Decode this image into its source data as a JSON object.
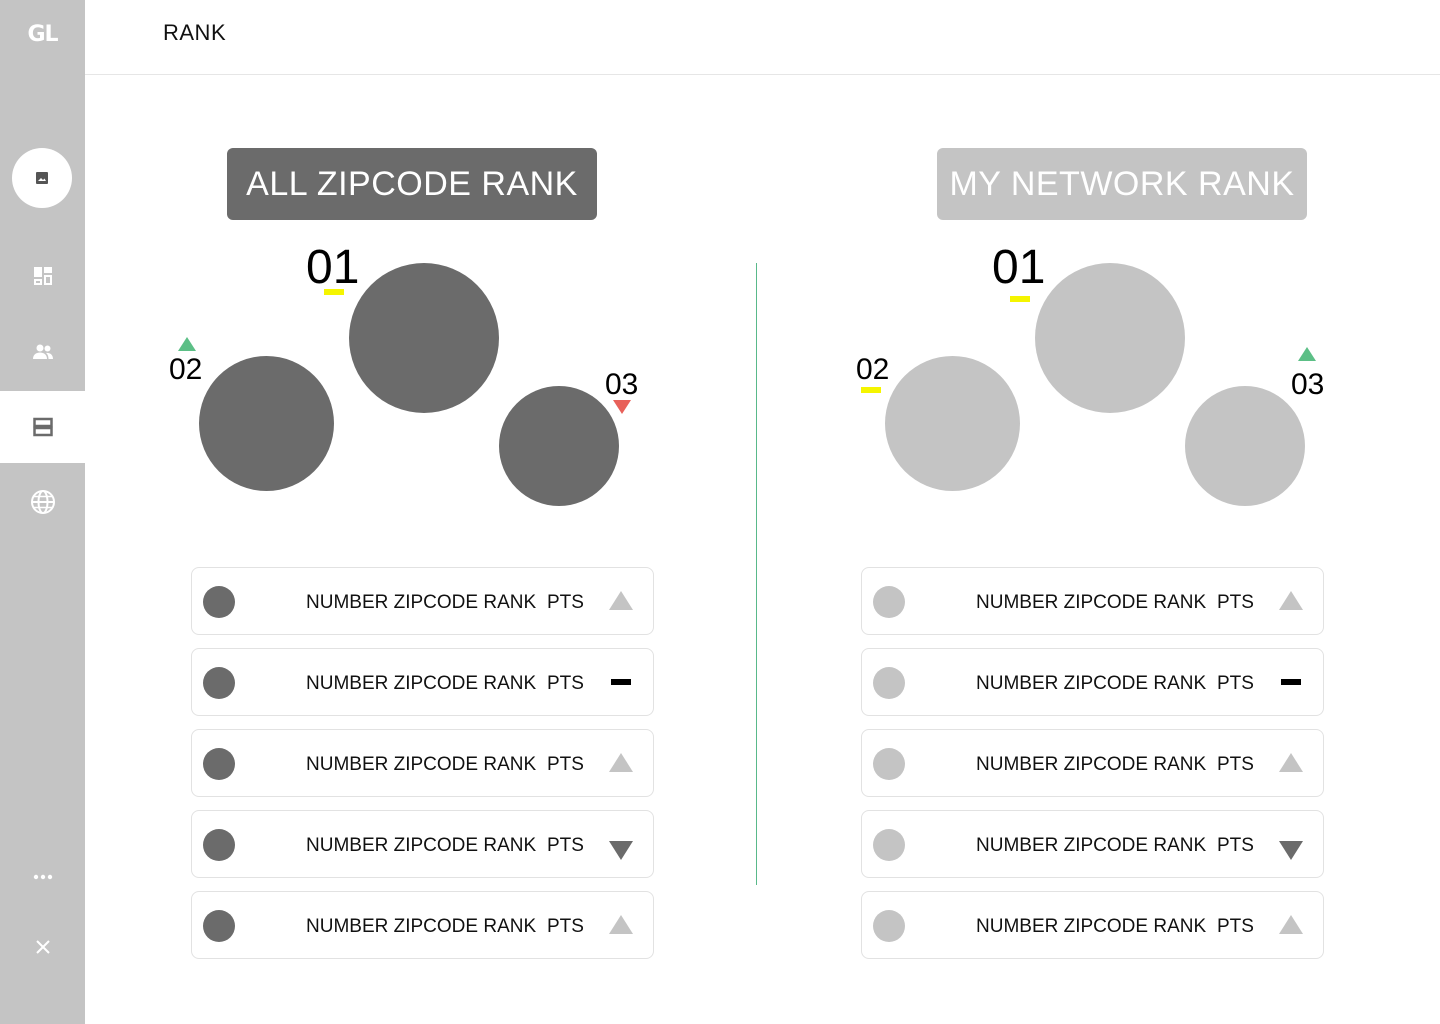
{
  "sidebar": {
    "logo": "GL",
    "nav": [
      {
        "icon": "dashboard-icon"
      },
      {
        "icon": "people-icon"
      },
      {
        "icon": "list-icon",
        "active": true
      },
      {
        "icon": "globe-icon"
      }
    ],
    "bottom": [
      {
        "icon": "more-icon"
      },
      {
        "icon": "close-icon"
      }
    ]
  },
  "header": {
    "title": "RANK"
  },
  "tabs": {
    "all": {
      "label": "ALL ZIPCODE RANK",
      "selected": true
    },
    "network": {
      "label": "MY NETWORK RANK",
      "selected": false
    }
  },
  "podium_all": {
    "first": {
      "rank": "01",
      "trend": "same"
    },
    "second": {
      "rank": "02",
      "trend": "up"
    },
    "third": {
      "rank": "03",
      "trend": "down"
    }
  },
  "podium_network": {
    "first": {
      "rank": "01",
      "trend": "same"
    },
    "second": {
      "rank": "02",
      "trend": "same"
    },
    "third": {
      "rank": "03",
      "trend": "up"
    }
  },
  "list_all": [
    {
      "label": "NUMBER ZIPCODE RANK",
      "pts": "PTS",
      "trend": "up"
    },
    {
      "label": "NUMBER ZIPCODE RANK",
      "pts": "PTS",
      "trend": "same"
    },
    {
      "label": "NUMBER ZIPCODE RANK",
      "pts": "PTS",
      "trend": "up"
    },
    {
      "label": "NUMBER ZIPCODE RANK",
      "pts": "PTS",
      "trend": "down"
    },
    {
      "label": "NUMBER ZIPCODE RANK",
      "pts": "PTS",
      "trend": "up"
    }
  ],
  "list_network": [
    {
      "label": "NUMBER ZIPCODE RANK",
      "pts": "PTS",
      "trend": "up"
    },
    {
      "label": "NUMBER ZIPCODE RANK",
      "pts": "PTS",
      "trend": "same"
    },
    {
      "label": "NUMBER ZIPCODE RANK",
      "pts": "PTS",
      "trend": "up"
    },
    {
      "label": "NUMBER ZIPCODE RANK",
      "pts": "PTS",
      "trend": "down"
    },
    {
      "label": "NUMBER ZIPCODE RANK",
      "pts": "PTS",
      "trend": "up"
    }
  ],
  "colors": {
    "sidebar": "#c4c4c4",
    "dark": "#6b6b6b",
    "light": "#c4c4c4",
    "up": "#5cbf86",
    "down": "#e8615a",
    "same": "#f5f500",
    "divider": "#59b98a"
  }
}
